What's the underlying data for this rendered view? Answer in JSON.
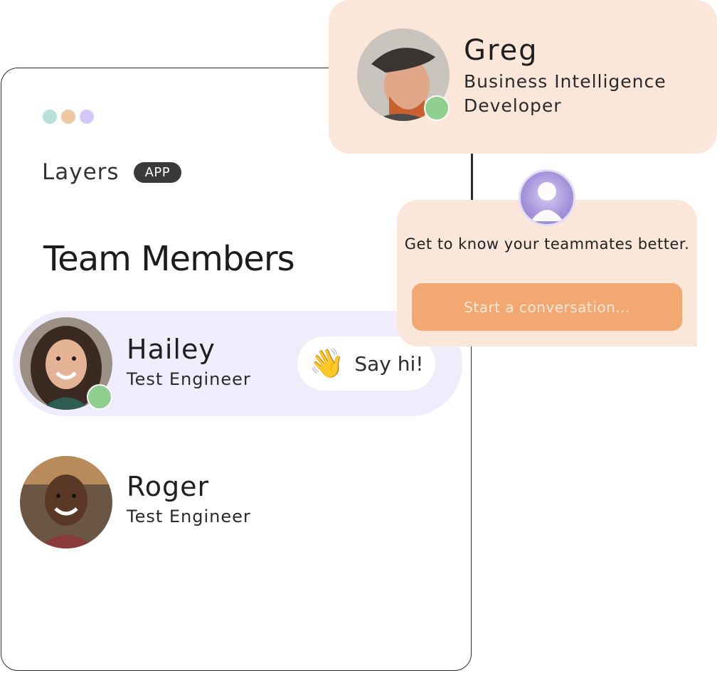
{
  "app": {
    "brand_name": "Layers",
    "brand_badge": "APP",
    "page_title": "Team Members"
  },
  "window_dots": [
    "#b6e0d8",
    "#eec7a3",
    "#d4c8fb"
  ],
  "members": [
    {
      "name": "Hailey",
      "role": "Test Engineer",
      "online": true,
      "highlighted": true,
      "action": {
        "emoji": "👋",
        "label": "Say hi!"
      }
    },
    {
      "name": "Roger",
      "role": "Test Engineer",
      "online": false,
      "highlighted": false
    }
  ],
  "profile_card": {
    "name": "Greg",
    "role": "Business Intelligence Developer",
    "online": true
  },
  "conversation_card": {
    "prompt": "Get to know your teammates better.",
    "input_placeholder": "Start a conversation..."
  },
  "colors": {
    "online_status": "#8fd08f",
    "highlight_row": "#efecfc",
    "card_background": "#fbe6da",
    "cta_button": "#f2a870"
  }
}
